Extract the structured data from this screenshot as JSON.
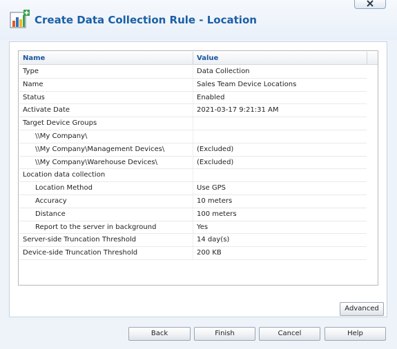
{
  "dialog": {
    "title": "Create Data Collection Rule - Location"
  },
  "grid": {
    "header_name": "Name",
    "header_value": "Value",
    "rows": [
      {
        "name": "Type",
        "value": "Data Collection",
        "level": 0
      },
      {
        "name": "Name",
        "value": "Sales Team Device Locations",
        "level": 0
      },
      {
        "name": "Status",
        "value": "Enabled",
        "level": 0
      },
      {
        "name": "Activate Date",
        "value": "2021-03-17 9:21:31 AM",
        "level": 0
      },
      {
        "name": "Target Device Groups",
        "value": "",
        "level": 0
      },
      {
        "name": "\\\\My Company\\",
        "value": "",
        "level": 1
      },
      {
        "name": "\\\\My Company\\Management Devices\\",
        "value": "(Excluded)",
        "level": 1
      },
      {
        "name": "\\\\My Company\\Warehouse Devices\\",
        "value": "(Excluded)",
        "level": 1
      },
      {
        "name": "Location data collection",
        "value": "",
        "level": 0
      },
      {
        "name": "Location Method",
        "value": "Use GPS",
        "level": 1
      },
      {
        "name": "Accuracy",
        "value": "10 meters",
        "level": 1
      },
      {
        "name": "Distance",
        "value": "100 meters",
        "level": 1
      },
      {
        "name": "Report to the server in background",
        "value": "Yes",
        "level": 1
      },
      {
        "name": "Server-side Truncation Threshold",
        "value": "14 day(s)",
        "level": 0
      },
      {
        "name": "Device-side Truncation Threshold",
        "value": "200 KB",
        "level": 0
      }
    ]
  },
  "buttons": {
    "advanced": "Advanced",
    "back": "Back",
    "finish": "Finish",
    "cancel": "Cancel",
    "help": "Help"
  },
  "icons": {
    "close": "close-icon",
    "app": "chart-add-icon"
  },
  "colors": {
    "title": "#1b5fa6",
    "header_text": "#1a56a0"
  }
}
